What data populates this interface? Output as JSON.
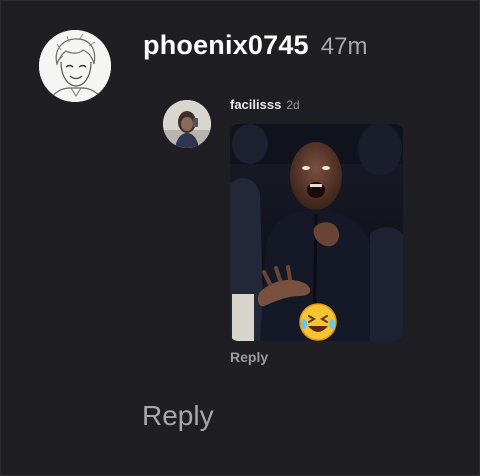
{
  "comment": {
    "username": "phoenix0745",
    "time": "47m",
    "avatar_icon": "anime-sketch-avatar",
    "reply_label": "Reply"
  },
  "nested_reply": {
    "username": "facilisss",
    "time": "2d",
    "avatar_icon": "profile-photo-avatar",
    "media": "gif-man-laughing-with-laughing-emoji",
    "emoji": "rolling-on-floor-laughing-emoji",
    "reply_label": "Reply"
  },
  "colors": {
    "background": "#1f1f23",
    "username": "#ffffff",
    "timestamp": "#a9a9ad",
    "reply_text": "#a7a7ab"
  }
}
